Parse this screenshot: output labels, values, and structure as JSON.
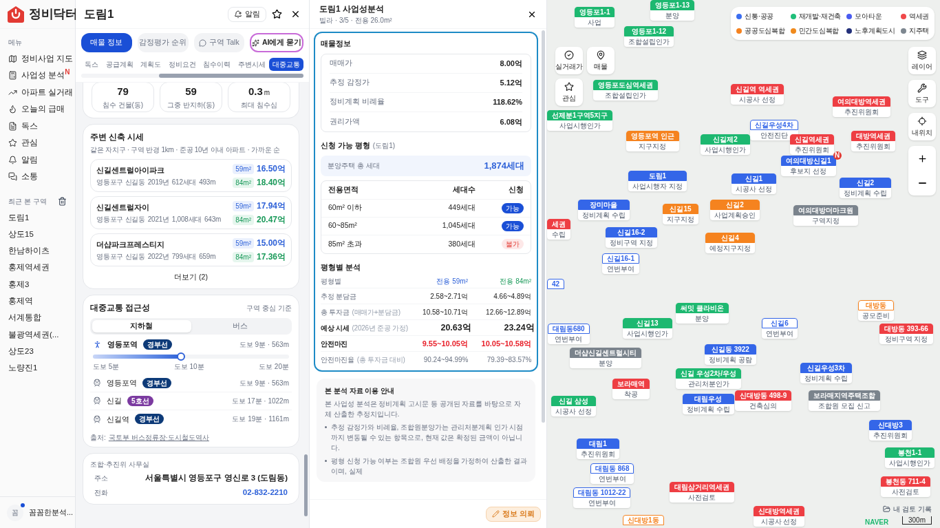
{
  "sidebar": {
    "logo": "정비닥터",
    "menu_label": "메뉴",
    "items": [
      {
        "kind": "map",
        "label": "정비사업 지도"
      },
      {
        "kind": "calc",
        "label": "사업성 분석",
        "badge": "N"
      },
      {
        "kind": "trend",
        "label": "아파트 실거래"
      },
      {
        "kind": "flame",
        "label": "오늘의 급매"
      },
      {
        "kind": "doc",
        "label": "독스"
      },
      {
        "kind": "star",
        "label": "관심"
      },
      {
        "kind": "bell",
        "label": "알림"
      },
      {
        "kind": "chat",
        "label": "소통"
      }
    ],
    "recent_label": "최근 본 구역",
    "recent": [
      "도림1",
      "상도15",
      "한남하이츠",
      "홍제역세권",
      "홍제3",
      "홍제역",
      "서계통합",
      "불광역세권(...",
      "상도23",
      "노량진1"
    ],
    "user": {
      "avatar": "꼼",
      "name": "꼼꼼한분석...",
      "notify": true
    }
  },
  "panel": {
    "title": "도림1",
    "alert_button": "알림",
    "tabs": [
      {
        "kind": "plain",
        "label": "매물 정보",
        "selected": true
      },
      {
        "kind": "plain",
        "label": "감정평가 순위",
        "selected": false
      },
      {
        "kind": "talk",
        "label": "구역 Talk",
        "selected": false
      },
      {
        "kind": "ai",
        "label": "AI에게 묻기",
        "selected": false
      }
    ],
    "subtabs": [
      {
        "label": "독스",
        "selected": false
      },
      {
        "label": "공급계획",
        "selected": false
      },
      {
        "label": "계획도",
        "selected": false
      },
      {
        "label": "정비요건",
        "selected": false
      },
      {
        "label": "침수이력",
        "selected": false
      },
      {
        "label": "주변시세",
        "selected": false
      },
      {
        "label": "대중교통",
        "selected": true
      }
    ],
    "flood_stats": [
      {
        "value": "79",
        "label": "침수 건물(동)"
      },
      {
        "value": "59",
        "label": "그중 반지하(동)"
      },
      {
        "value": "0.3",
        "unit": "m",
        "label": "최대 침수심"
      }
    ],
    "nearby": {
      "title": "주변 신축 시세",
      "subtitle": "같은 자치구 · 구역 반경 1km · 준공 10년 이내 아파트 · 가까운 순",
      "items": [
        {
          "name": "신길센트럴아이파크",
          "info": [
            "영등포구 신길동",
            "2019년",
            "612세대",
            "493m"
          ],
          "prices": [
            {
              "kind": "small",
              "area": "59m²",
              "price": "16.50억"
            },
            {
              "kind": "large",
              "area": "84m²",
              "price": "18.40억"
            }
          ]
        },
        {
          "name": "신길센트럴자이",
          "info": [
            "영등포구 신길동",
            "2021년",
            "1,008세대",
            "643m"
          ],
          "prices": [
            {
              "kind": "small",
              "area": "59m²",
              "price": "17.94억"
            },
            {
              "kind": "large",
              "area": "84m²",
              "price": "20.47억"
            }
          ]
        },
        {
          "name": "더샵파크프레스티지",
          "info": [
            "영등포구 신길동",
            "2022년",
            "799세대",
            "659m"
          ],
          "prices": [
            {
              "kind": "small",
              "area": "59m²",
              "price": "15.00억"
            },
            {
              "kind": "large",
              "area": "84m²",
              "price": "17.36억"
            }
          ]
        }
      ],
      "more": "더보기 (2)"
    },
    "transit": {
      "title": "대중교통 접근성",
      "basis": "구역 중심 기준",
      "modes": [
        {
          "label": "지하철",
          "selected": true
        },
        {
          "label": "버스",
          "selected": false
        }
      ],
      "nearest": {
        "name": "영등포역",
        "line": {
          "label": "경부선",
          "color": "#0d3a78"
        },
        "distance": "도보 9분 · 563m",
        "level": 0.45,
        "scale": [
          "도보 5분",
          "도보 10분",
          "도보 20분"
        ]
      },
      "stations": [
        {
          "name": "영등포역",
          "line": {
            "label": "경부선",
            "color": "#0d3a78"
          },
          "distance": "도보 9분 · 563m"
        },
        {
          "name": "신길",
          "line": {
            "label": "5호선",
            "color": "#7b3aa0"
          },
          "distance": "도보 17분 · 1022m"
        },
        {
          "name": "신길역",
          "line": {
            "label": "경부선",
            "color": "#0d3a78"
          },
          "distance": "도보 19분 · 1161m"
        }
      ],
      "source_label": "출처:",
      "source_link": "국토부 버스정류장·도시철도역사"
    },
    "office": {
      "title": "조합·추진위 사무실",
      "rows": [
        {
          "kind": "text",
          "label": "주소",
          "value": "서울특별시 영등포구 영신로 3 (도림동)"
        },
        {
          "kind": "phone",
          "label": "전화",
          "value": "02-832-2210"
        }
      ]
    }
  },
  "analysis": {
    "title": "도림1 사업성분석",
    "subtitle": "빌라 · 3/5 · 전용 26.0m²",
    "property": {
      "title": "매물정보",
      "rows": [
        {
          "label": "매매가",
          "value": "8.00억"
        },
        {
          "label": "추정 감정가",
          "value": "5.12억"
        },
        {
          "label": "정비계획 비례율",
          "value": "118.62%"
        },
        {
          "label": "권리가액",
          "value": "6.08억"
        }
      ]
    },
    "eligible": {
      "title": "신청 가능 평형",
      "area": "(도림1)",
      "total_label": "분양주택 총 세대",
      "total": "1,874세대",
      "columns": [
        "전용면적",
        "세대수",
        "신청"
      ],
      "rows": [
        {
          "area": "60m² 이하",
          "units": "449세대",
          "status": "가능",
          "available": true
        },
        {
          "area": "60~85m²",
          "units": "1,045세대",
          "status": "가능",
          "available": true
        },
        {
          "area": "85m² 초과",
          "units": "380세대",
          "status": "불가",
          "available": false
        }
      ]
    },
    "by_size": {
      "title": "평형별 분석",
      "header": {
        "label": "평형별",
        "a": "전용 59m²",
        "b": "전용 84m²"
      },
      "rows": [
        {
          "kind": "normal",
          "label": "추정 분담금",
          "a": "2.58~2.71억",
          "b": "4.66~4.89억"
        },
        {
          "kind": "normal",
          "label": "총 투자금",
          "note": "(매매가+분담금)",
          "a": "10.58~10.71억",
          "b": "12.66~12.89억"
        },
        {
          "kind": "strong",
          "label": "예상 시세",
          "note": "(2026년 준공 가정)",
          "a": "20.63억",
          "b": "23.24억"
        },
        {
          "kind": "margin",
          "label": "안전마진",
          "a": "9.55~10.05억",
          "b": "10.05~10.58억"
        },
        {
          "kind": "muted",
          "label": "안전마진율",
          "note": "(총 투자금 대비)",
          "a": "90.24~94.99%",
          "b": "79.39~83.57%"
        }
      ]
    },
    "notice": {
      "title": "본 분석 자료 이용 안내",
      "intro": "본 사업성 분석은 정비계획 고시문 등 공개된 자료를 바탕으로 자체 산출한 추정치입니다.",
      "bullets": [
        "추정 감정가와 비례율, 조합원분양가는 관리처분계획 인가 시점까지 변동될 수 있는 항목으로, 현재 값은 확정된 금액이 아닙니다.",
        "평형 신청 가능 여부는 조합원 우선 배정을 가정하여 산출한 결과이며, 실제"
      ]
    },
    "request_button": "정보 의뢰"
  },
  "map": {
    "legend": [
      {
        "label": "신통·공공",
        "color": "#3b6ef0"
      },
      {
        "label": "재개발·재건축",
        "color": "#1fbf7a"
      },
      {
        "label": "모아타운",
        "color": "#4a5cf0"
      },
      {
        "label": "역세권",
        "color": "#f0484a"
      },
      {
        "label": "공공도심복합",
        "color": "#f5821f"
      },
      {
        "label": "민간도심복합",
        "color": "#f08a1c"
      },
      {
        "label": "노후계획도시",
        "color": "#23307a"
      },
      {
        "label": "지주택",
        "color": "#7d8790"
      }
    ],
    "left_controls": [
      {
        "kind": "check",
        "label": "실거래가"
      },
      {
        "kind": "pin",
        "label": "매물"
      },
      {
        "kind": "star",
        "label": "관심"
      }
    ],
    "right_controls": [
      {
        "kind": "layers",
        "label": "레이어"
      },
      {
        "kind": "wrench",
        "label": "도구"
      },
      {
        "kind": "locate",
        "label": "내위치"
      }
    ],
    "markers": [
      {
        "name": "영등포1-1",
        "status": "사업",
        "color": "#1db870",
        "outline": false
      },
      {
        "name": "영등포1-13",
        "status": "분양",
        "color": "#1db870",
        "outline": false
      },
      {
        "name": "영등포1-12",
        "status": "조합설립인가",
        "color": "#1db870",
        "outline": false
      },
      {
        "name": "영등포도심역세권",
        "status": "조합설립인가",
        "color": "#1db870",
        "outline": false
      },
      {
        "name": "신길역 역세권",
        "status": "시공사 선정",
        "color": "#ee3e43",
        "outline": false
      },
      {
        "name": "여의대방역세권",
        "status": "추진위원회",
        "color": "#ee3e43",
        "outline": false
      },
      {
        "name": "선제분1구역5지구",
        "status": "사업시행인가",
        "color": "#1db870",
        "outline": false
      },
      {
        "name": "신길우성4차",
        "status": "안전진단",
        "color": "#3466e8",
        "outline": true
      },
      {
        "name": "영등포역 인근",
        "status": "지구지정",
        "color": "#f5831f",
        "outline": false
      },
      {
        "name": "신길제2",
        "status": "사업시행인가",
        "color": "#1db870",
        "outline": false
      },
      {
        "name": "신길역세권",
        "status": "추진위원회",
        "color": "#ee3e43",
        "outline": false
      },
      {
        "name": "대방역세권",
        "status": "추진위원회",
        "color": "#ee3e43",
        "outline": false
      },
      {
        "name": "여의대방신길1",
        "status": "후보지 선정",
        "color": "#3466e8",
        "outline": false,
        "badge": "N"
      },
      {
        "name": "도림1",
        "status": "사업시행자 지정",
        "color": "#3466e8",
        "outline": false
      },
      {
        "name": "신길1",
        "status": "시공사 선정",
        "color": "#3466e8",
        "outline": false
      },
      {
        "name": "신길2",
        "status": "정비계획 수립",
        "color": "#3466e8",
        "outline": false
      },
      {
        "name": "장미마을",
        "status": "정비계획 수립",
        "color": "#3466e8",
        "outline": false
      },
      {
        "name": "신길15",
        "status": "지구지정",
        "color": "#f5831f",
        "outline": false
      },
      {
        "name": "신길2",
        "status": "사업계획승인",
        "color": "#f5831f",
        "outline": false
      },
      {
        "name": "여의대방더마크원",
        "status": "구역지정",
        "color": "#7a838c",
        "outline": false
      },
      {
        "name": "세권",
        "status": "수립",
        "color": "#ee3e43",
        "outline": false
      },
      {
        "name": "신길16-2",
        "status": "정비구역 지정",
        "color": "#3466e8",
        "outline": false
      },
      {
        "name": "신길4",
        "status": "예정지구지정",
        "color": "#f5831f",
        "outline": false
      },
      {
        "name": "신길16-1",
        "status": "연번부여",
        "color": "#3466e8",
        "outline": true
      },
      {
        "name": "42",
        "color": "#3466e8",
        "outline": true
      },
      {
        "name": "써밋 클라비온",
        "status": "분양",
        "color": "#1db870",
        "outline": false
      },
      {
        "name": "대방동",
        "status": "공모준비",
        "color": "#f5831f",
        "outline": true
      },
      {
        "name": "대림동680",
        "status": "연번부여",
        "color": "#3466e8",
        "outline": true
      },
      {
        "name": "신길13",
        "status": "사업시행인가",
        "color": "#1db870",
        "outline": false
      },
      {
        "name": "신길6",
        "status": "연번부여",
        "color": "#3466e8",
        "outline": true
      },
      {
        "name": "대방동 393-66",
        "status": "정비구역 지정",
        "color": "#ee3e43",
        "outline": false
      },
      {
        "name": "더샵신길센트럴시티",
        "status": "분양",
        "color": "#7a838c",
        "outline": false
      },
      {
        "name": "신길동 3922",
        "status": "정비계획 공람",
        "color": "#3466e8",
        "outline": false
      },
      {
        "name": "신길 우성2차/우성",
        "status": "관리처분인가",
        "color": "#1db870",
        "outline": false
      },
      {
        "name": "신길우성3차",
        "status": "정비계획 수립",
        "color": "#3466e8",
        "outline": false
      },
      {
        "name": "보라매역",
        "status": "착공",
        "color": "#ee3e43",
        "outline": false
      },
      {
        "name": "신길 삼성",
        "status": "시공사 선정",
        "color": "#1db870",
        "outline": false
      },
      {
        "name": "대림우성",
        "status": "정비계획 수립",
        "color": "#3466e8",
        "outline": false
      },
      {
        "name": "신대방동 498-9",
        "status": "건축심의",
        "color": "#ee3e43",
        "outline": false
      },
      {
        "name": "보라매지역주택조합",
        "status": "조합원 모집 신고",
        "color": "#7a838c",
        "outline": false
      },
      {
        "name": "신대방3",
        "status": "추진위원회",
        "color": "#3466e8",
        "outline": false
      },
      {
        "name": "대림1",
        "status": "추진위원회",
        "color": "#3466e8",
        "outline": false
      },
      {
        "name": "봉천1-1",
        "status": "사업시행인가",
        "color": "#1db870",
        "outline": false
      },
      {
        "name": "대림동 868",
        "status": "연번부여",
        "color": "#3466e8",
        "outline": true
      },
      {
        "name": "봉천동 711-4",
        "status": "사전검토",
        "color": "#ee3e43",
        "outline": false
      },
      {
        "name": "대림동 1012-22",
        "status": "연번부여",
        "color": "#3466e8",
        "outline": true
      },
      {
        "name": "대림삼거리역세권",
        "status": "사전검토",
        "color": "#ee3e43",
        "outline": false
      },
      {
        "name": "신대방1동",
        "color": "#f5831f",
        "outline": true
      },
      {
        "name": "신대방역세권",
        "status": "시공사 선정",
        "color": "#ee3e43",
        "outline": false
      }
    ],
    "history_button": "내 검토 기록",
    "attribution": "NAVER",
    "scale": "300m"
  }
}
